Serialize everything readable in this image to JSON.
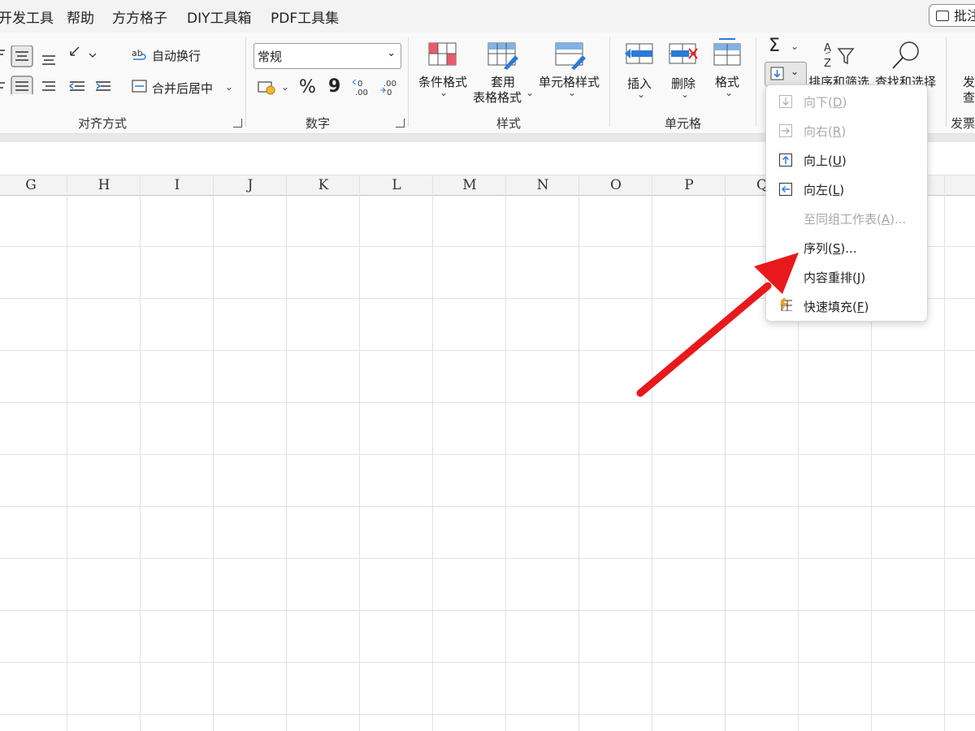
{
  "tabs": [
    "开发工具",
    "帮助",
    "方方格子",
    "DIY工具箱",
    "PDF工具集"
  ],
  "tab_first_visible": "开发工具",
  "comment_button": "批注",
  "ribbon": {
    "alignment": {
      "wrap_text": "自动换行",
      "merge_center": "合并后居中",
      "label": "对齐方式"
    },
    "number": {
      "format_value": "常规",
      "percent": "%",
      "comma": "9",
      "label": "数字"
    },
    "styles": {
      "conditional": "条件格式",
      "table_format_line1": "套用",
      "table_format_line2": "表格格式",
      "cell_styles": "单元格样式",
      "label": "样式"
    },
    "cells": {
      "insert": "插入",
      "delete": "删除",
      "format": "格式",
      "label": "单元格"
    },
    "editing": {
      "sum": "Σ",
      "sort_filter": "排序和筛选",
      "find_select": "查找和选择"
    },
    "invoice": {
      "line1": "发",
      "line2": "查",
      "label": "发票"
    }
  },
  "columns": [
    "G",
    "H",
    "I",
    "J",
    "K",
    "L",
    "M",
    "N",
    "O",
    "P",
    "Q"
  ],
  "fill_menu": {
    "items": [
      {
        "label": "向下",
        "key": "D",
        "enabled": false,
        "icon": "fill-down-icon"
      },
      {
        "label": "向右",
        "key": "R",
        "enabled": false,
        "icon": "fill-right-icon"
      },
      {
        "label": "向上",
        "key": "U",
        "enabled": true,
        "icon": "fill-up-icon"
      },
      {
        "label": "向左",
        "key": "L",
        "enabled": true,
        "icon": "fill-left-icon"
      },
      {
        "label": "至同组工作表",
        "key": "A",
        "suffix": "...",
        "enabled": false,
        "icon": ""
      },
      {
        "label": "序列",
        "key": "S",
        "suffix": "...",
        "enabled": true,
        "icon": ""
      },
      {
        "label": "内容重排",
        "key": "J",
        "enabled": true,
        "icon": ""
      },
      {
        "label": "快速填充",
        "key": "F",
        "enabled": true,
        "icon": "flash-fill-icon"
      }
    ]
  },
  "colors": {
    "accent_blue": "#2b7bd6",
    "annotation_arrow": "#e8191c",
    "style_red": "#e95b6a"
  }
}
